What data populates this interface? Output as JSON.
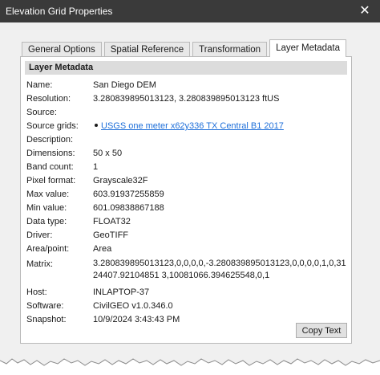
{
  "window": {
    "title": "Elevation Grid Properties",
    "close_symbol": "✕"
  },
  "tabs": [
    {
      "label": "General Options",
      "active": false
    },
    {
      "label": "Spatial Reference",
      "active": false
    },
    {
      "label": "Transformation",
      "active": false
    },
    {
      "label": "Layer Metadata",
      "active": true
    }
  ],
  "section": {
    "header": "Layer Metadata"
  },
  "fields": [
    {
      "key": "Name:",
      "value": "San Diego DEM"
    },
    {
      "key": "Resolution:",
      "value": "3.280839895013123, 3.280839895013123 ftUS"
    },
    {
      "key": "Source:",
      "value": ""
    },
    {
      "key": "Source grids:",
      "value": "USGS one meter x62y336 TX Central B1 2017",
      "link": true
    },
    {
      "key": "Description:",
      "value": ""
    },
    {
      "key": "Dimensions:",
      "value": "50 x 50"
    },
    {
      "key": "Band count:",
      "value": "1"
    },
    {
      "key": "Pixel format:",
      "value": "Grayscale32F"
    },
    {
      "key": "Max value:",
      "value": "603.91937255859"
    },
    {
      "key": "Min value:",
      "value": "601.09838867188"
    },
    {
      "key": "Data type:",
      "value": "FLOAT32"
    },
    {
      "key": "Driver:",
      "value": "GeoTIFF"
    },
    {
      "key": "Area/point:",
      "value": "Area"
    },
    {
      "key": "Matrix:",
      "value": "3.280839895013123,0,0,0,0,-3.280839895013123,0,0,0,0,1,0,3124407.92104851 3,10081066.394625548,0,1"
    },
    {
      "key": "Host:",
      "value": "INLAPTOP-37"
    },
    {
      "key": "Software:",
      "value": "CivilGEO v1.0.346.0"
    },
    {
      "key": "Snapshot:",
      "value": "10/9/2024 3:43:43 PM"
    }
  ],
  "buttons": {
    "copy_text": "Copy Text"
  },
  "colors": {
    "titlebar": "#3a3a3a",
    "link": "#1e6fd9",
    "header_band": "#dcdcdc"
  }
}
